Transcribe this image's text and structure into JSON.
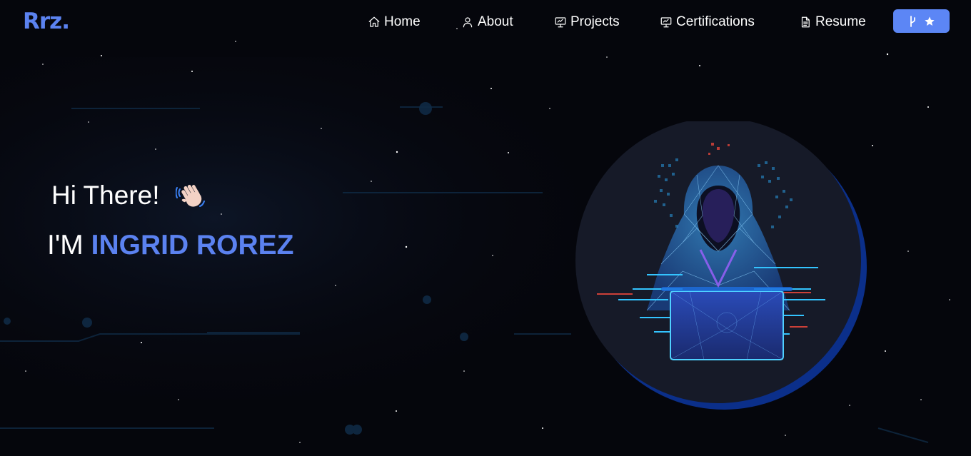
{
  "brand": {
    "logo_text": "Rrz."
  },
  "nav": {
    "items": [
      {
        "label": "Home",
        "icon": "home-icon"
      },
      {
        "label": "About",
        "icon": "user-icon"
      },
      {
        "label": "Projects",
        "icon": "presentation-icon"
      },
      {
        "label": "Certifications",
        "icon": "presentation-icon"
      },
      {
        "label": "Resume",
        "icon": "document-icon"
      }
    ],
    "github_button": {
      "icons": [
        "git-fork-icon",
        "star-icon"
      ]
    }
  },
  "hero": {
    "greeting": "Hi There!",
    "greeting_emoji": "waving-hand-icon",
    "intro_prefix": "I'M ",
    "name": "INGRID ROREZ",
    "image": "hooded-hacker-illustration"
  },
  "colors": {
    "accent": "#5b82f0",
    "background": "#05060c",
    "button": "#5c86f5",
    "circle": "#161a28",
    "circle_shadow": "#0b2f8a"
  }
}
